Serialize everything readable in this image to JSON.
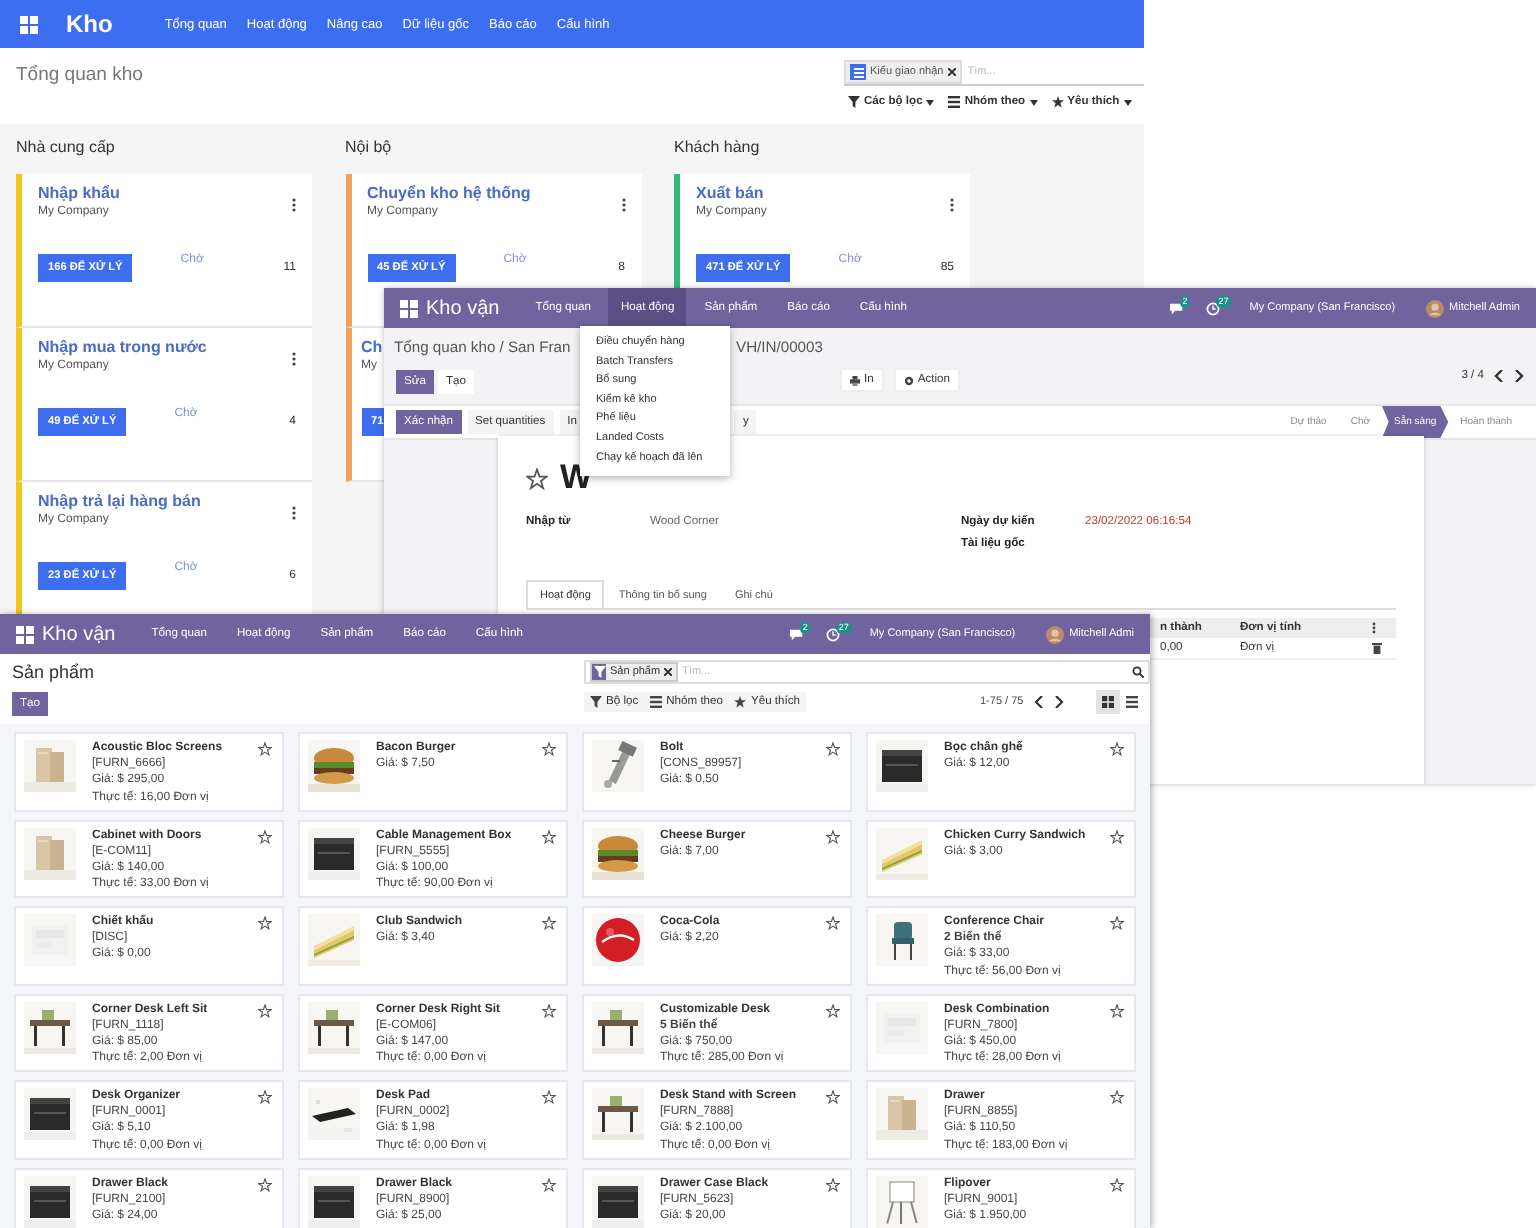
{
  "warehouse_overview": {
    "navbar": {
      "app": "Kho",
      "menus": [
        "Tổng quan",
        "Hoạt động",
        "Nâng cao",
        "Dữ liệu gốc",
        "Báo cáo",
        "Cấu hình"
      ]
    },
    "title": "Tổng quan kho",
    "search": {
      "facet": "Kiểu giao nhận",
      "placeholder": "Tìm..."
    },
    "filters": [
      "Các bộ lọc",
      "Nhóm theo",
      "Yêu thích"
    ],
    "columns": [
      {
        "title": "Nhà cung cấp",
        "color": "#f4c51d",
        "cards": [
          {
            "name": "Nhập khẩu",
            "company": "My Company",
            "button": "166 ĐỂ XỬ LÝ",
            "waiting_label": "Chờ",
            "waiting_count": "11"
          },
          {
            "name": "Nhập mua trong nước",
            "company": "My Company",
            "button": "49 ĐỂ XỬ LÝ",
            "waiting_label": "Chờ",
            "waiting_count": "4"
          },
          {
            "name": "Nhập trả lại hàng bán",
            "company": "My Company",
            "button": "23 ĐỂ XỬ LÝ",
            "waiting_label": "Chờ",
            "waiting_count": "6"
          }
        ]
      },
      {
        "title": "Nội bộ",
        "color": "#f0a15c",
        "cards": [
          {
            "name": "Chuyển kho hệ thống",
            "company": "My Company",
            "button": "45 ĐỂ XỬ LÝ",
            "waiting_label": "Chờ",
            "waiting_count": "8"
          },
          {
            "name": "Ch",
            "company": "My",
            "button": "71"
          }
        ]
      },
      {
        "title": "Khách hàng",
        "color": "#2fb87a",
        "cards": [
          {
            "name": "Xuất bán",
            "company": "My Company",
            "button": "471 ĐỂ XỬ LÝ",
            "waiting_label": "Chờ",
            "waiting_count": "85"
          }
        ]
      }
    ]
  },
  "receipt_form": {
    "navbar": {
      "app": "Kho vận",
      "menus": [
        {
          "label": "Tổng quan",
          "open": false
        },
        {
          "label": "Hoạt động",
          "open": true
        },
        {
          "label": "Sản phẩm",
          "open": false
        },
        {
          "label": "Báo cáo",
          "open": false
        },
        {
          "label": "Cấu hình",
          "open": false
        }
      ],
      "messages_badge": "2",
      "activities_badge": "27",
      "company": "My Company (San Francisco)",
      "user": "Mitchell Admin"
    },
    "breadcrumb": "Tổng quan kho / San Fran",
    "record_ref": "VH/IN/00003",
    "buttons": [
      {
        "label": "Sửa",
        "kind": "primary"
      },
      {
        "label": "Tạo",
        "kind": "secondary"
      }
    ],
    "print_button": "In",
    "action_button": "Action",
    "pager": "3 / 4",
    "actions": [
      {
        "label": "Xác nhận",
        "kind": "primary"
      },
      {
        "label": "Set quantities",
        "kind": "secondary"
      },
      {
        "label": "In",
        "kind": "secondary"
      }
    ],
    "action_fragment": "y",
    "stages": [
      {
        "label": "Dự thảo",
        "selected": false
      },
      {
        "label": "Chờ",
        "selected": false
      },
      {
        "label": "Sẵn sàng",
        "selected": true
      },
      {
        "label": "Hoàn thành",
        "selected": false
      }
    ],
    "sheet": {
      "title": "W",
      "left_fields": [
        {
          "label": "Nhập từ",
          "value": "Wood Corner"
        }
      ],
      "right_fields": [
        {
          "label": "Ngày dự kiến",
          "value": "23/02/2022 06:16:54",
          "late": true
        },
        {
          "label": "Tài liệu gốc"
        }
      ],
      "tabs": [
        {
          "label": "Hoạt động",
          "selected": true
        },
        {
          "label": "Thông tin bổ sung",
          "selected": false
        },
        {
          "label": "Ghi chú",
          "selected": false
        }
      ],
      "table": {
        "columns": [
          "n thành",
          "Đơn vị tính"
        ],
        "rows": [
          [
            "0,00",
            "Đơn vị"
          ]
        ]
      }
    },
    "dropdown_menu": [
      "Điều chuyển hàng",
      "Batch Transfers",
      "Bổ sung",
      "Kiểm kê kho",
      "Phế liệu",
      "Landed Costs",
      "Chạy kế hoạch đã lên"
    ]
  },
  "products": {
    "navbar": {
      "app": "Kho vận",
      "menus": [
        {
          "label": "Tổng quan",
          "open": false
        },
        {
          "label": "Hoạt động",
          "open": false
        },
        {
          "label": "Sản phẩm",
          "open": false
        },
        {
          "label": "Báo cáo",
          "open": false
        },
        {
          "label": "Cấu hình",
          "open": false
        }
      ],
      "messages_badge": "2",
      "activities_badge": "27",
      "company": "My Company (San Francisco)",
      "user": "Mitchell Admi"
    },
    "title": "Sản phẩm",
    "create_button": "Tạo",
    "search": {
      "facet": "Sản phẩm",
      "placeholder": "Tìm..."
    },
    "filters": [
      "Bộ lọc",
      "Nhóm theo",
      "Yêu thích"
    ],
    "pager": "1-75 / 75",
    "view_modes": [
      {
        "kind": "kanban",
        "selected": true
      },
      {
        "kind": "list",
        "selected": false
      }
    ],
    "items": [
      {
        "name": "Acoustic Bloc Screens",
        "code": "[FURN_6666]",
        "price": "Giá: $ 295,00",
        "on_hand": "Thực tế: 16,00 Đơn vị"
      },
      {
        "name": "Bacon Burger",
        "price": "Giá: $ 7,50"
      },
      {
        "name": "Bolt",
        "code": "[CONS_89957]",
        "price": "Giá: $ 0,50"
      },
      {
        "name": "Bọc chân ghế",
        "price": "Giá: $ 12,00"
      },
      {
        "name": "Cabinet with Doors",
        "code": "[E-COM11]",
        "price": "Giá: $ 140,00",
        "on_hand": "Thực tế: 33,00 Đơn vị"
      },
      {
        "name": "Cable Management Box",
        "code": "[FURN_5555]",
        "price": "Giá: $ 100,00",
        "on_hand": "Thực tế: 90,00 Đơn vị"
      },
      {
        "name": "Cheese Burger",
        "price": "Giá: $ 7,00"
      },
      {
        "name": "Chicken Curry Sandwich",
        "price": "Giá: $ 3,00"
      },
      {
        "name": "Chiết khấu",
        "code": "[DISC]",
        "price": "Giá: $ 0,00"
      },
      {
        "name": "Club Sandwich",
        "price": "Giá: $ 3,40"
      },
      {
        "name": "Coca-Cola",
        "price": "Giá: $ 2,20"
      },
      {
        "name": "Conference Chair",
        "variants": "2 Biến thể",
        "price": "Giá: $ 33,00",
        "on_hand": "Thực tế: 56,00 Đơn vị"
      },
      {
        "name": "Corner Desk Left Sit",
        "code": "[FURN_1118]",
        "price": "Giá: $ 85,00",
        "on_hand": "Thực tế: 2,00 Đơn vị"
      },
      {
        "name": "Corner Desk Right Sit",
        "code": "[E-COM06]",
        "price": "Giá: $ 147,00",
        "on_hand": "Thực tế: 0,00 Đơn vị"
      },
      {
        "name": "Customizable Desk",
        "variants": "5 Biến thể",
        "price": "Giá: $ 750,00",
        "on_hand": "Thực tế: 285,00 Đơn vị"
      },
      {
        "name": "Desk Combination",
        "code": "[FURN_7800]",
        "price": "Giá: $ 450,00",
        "on_hand": "Thực tế: 28,00 Đơn vị"
      },
      {
        "name": "Desk Organizer",
        "code": "[FURN_0001]",
        "price": "Giá: $ 5,10",
        "on_hand": "Thực tế: 0,00 Đơn vị"
      },
      {
        "name": "Desk Pad",
        "code": "[FURN_0002]",
        "price": "Giá: $ 1,98",
        "on_hand": "Thực tế: 0,00 Đơn vị"
      },
      {
        "name": "Desk Stand with Screen",
        "code": "[FURN_7888]",
        "price": "Giá: $ 2.100,00",
        "on_hand": "Thực tế: 0,00 Đơn vị"
      },
      {
        "name": "Drawer",
        "code": "[FURN_8855]",
        "price": "Giá: $ 110,50",
        "on_hand": "Thực tế: 183,00 Đơn vị"
      },
      {
        "name": "Drawer Black",
        "code": "[FURN_2100]",
        "price": "Giá: $ 24,00"
      },
      {
        "name": "Drawer Black",
        "code": "[FURN_8900]",
        "price": "Giá: $ 25,00"
      },
      {
        "name": "Drawer Case Black",
        "code": "[FURN_5623]",
        "price": "Giá: $ 20,00"
      },
      {
        "name": "Flipover",
        "code": "[FURN_9001]",
        "price": "Giá: $ 1.950,00"
      }
    ]
  }
}
